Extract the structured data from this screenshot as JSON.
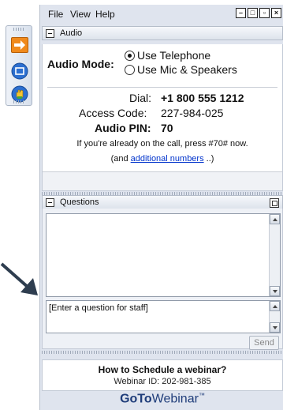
{
  "menu": {
    "file": "File",
    "view": "View",
    "help": "Help"
  },
  "audio": {
    "section_title": "Audio",
    "mode_label": "Audio Mode:",
    "options": [
      {
        "label": "Use Telephone",
        "selected": true
      },
      {
        "label": "Use Mic & Speakers",
        "selected": false
      }
    ],
    "dial_label": "Dial:",
    "dial_value": "+1 800 555 1212",
    "access_label": "Access Code:",
    "access_value": "227-984-025",
    "pin_label": "Audio PIN:",
    "pin_value": "70",
    "note": "If you're already on the call, press #70# now.",
    "numbers_prefix": "(and ",
    "numbers_link": "additional numbers",
    "numbers_suffix": " ..)"
  },
  "questions": {
    "section_title": "Questions",
    "input_placeholder": "[Enter a question for staff]",
    "send_label": "Send"
  },
  "footer": {
    "schedule_title": "How to Schedule a webinar?",
    "webinar_id": "Webinar ID: 202-981-385",
    "brand_bold": "GoTo",
    "brand_rest": "Webinar",
    "brand_tm": "™"
  },
  "colors": {
    "accent_orange": "#f08a1c",
    "brand_blue": "#1f3d7a",
    "link_blue": "#0033cc"
  }
}
